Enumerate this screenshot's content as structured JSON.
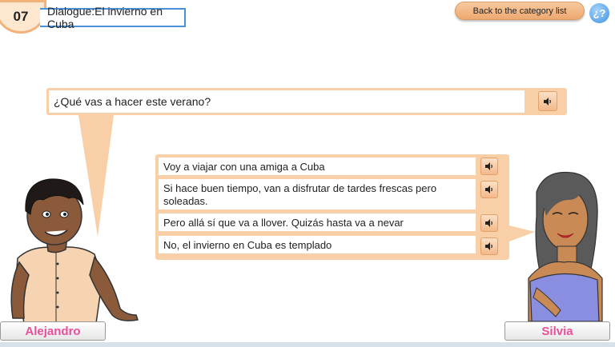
{
  "header": {
    "lesson_number": "07",
    "lesson_title": "Dialogue:El invierno en Cuba",
    "back_label": "Back to the category list",
    "help_label": "¿?"
  },
  "question": {
    "text": "¿Qué vas a hacer este verano?"
  },
  "answers": [
    "Voy a viajar con una amiga a Cuba",
    "Si hace buen tiempo, van a disfrutar de tardes frescas pero soleadas.",
    "Pero allá sí que va a llover. Quizás hasta va a nevar",
    "No, el invierno en Cuba es templado"
  ],
  "characters": {
    "left_name": "Alejandro",
    "right_name": "Silvia"
  },
  "colors": {
    "accent": "#f8cfa7",
    "name_pink": "#ea4f9a",
    "title_border": "#4a90d9"
  },
  "icons": {
    "audio": "speaker-icon",
    "help": "question-icon"
  }
}
